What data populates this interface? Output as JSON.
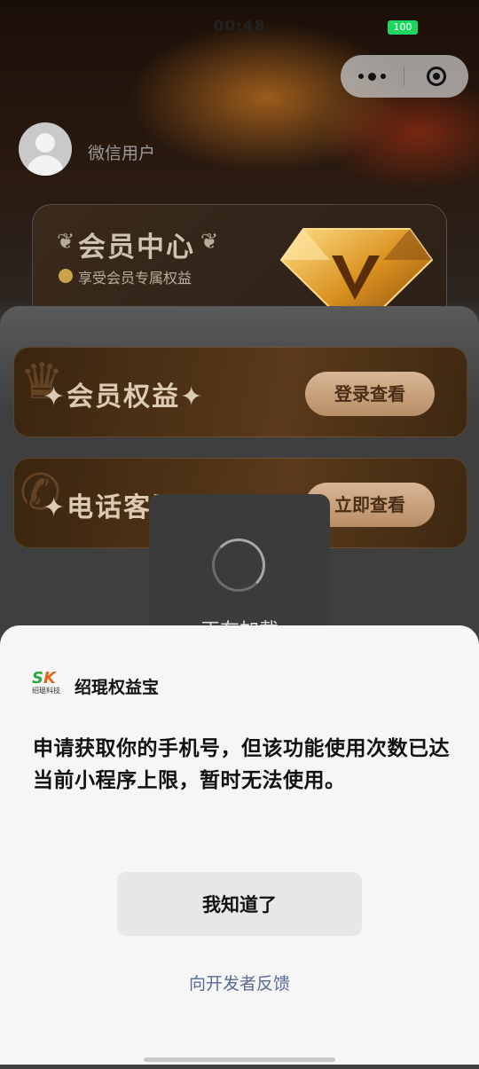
{
  "status_bar": {
    "time": "00:48",
    "battery": "100"
  },
  "capsule": {
    "more_icon": "more-dots-icon",
    "close_icon": "target-close-icon"
  },
  "user": {
    "name": "微信用户"
  },
  "member_card": {
    "title": "会员中心",
    "subtitle": "享受会员专属权益"
  },
  "features": [
    {
      "label": "✦会员权益✦",
      "button": "登录查看",
      "icon": "crown-icon"
    },
    {
      "label": "✦电话客服✦",
      "button": "立即查看",
      "icon": "phone-icon"
    }
  ],
  "loading": {
    "text": "正在加载"
  },
  "dialog": {
    "app_logo_text": "SK",
    "app_logo_sub": "绍琨科技",
    "app_name": "绍琨权益宝",
    "message": "申请获取你的手机号，但该功能使用次数已达当前小程序上限，暂时无法使用。",
    "ok_label": "我知道了",
    "feedback_label": "向开发者反馈"
  },
  "colors": {
    "link": "#576b95",
    "sheet_bg": "#f6f6f6",
    "button_bg": "#e7e7e7",
    "battery": "#1ed760"
  }
}
